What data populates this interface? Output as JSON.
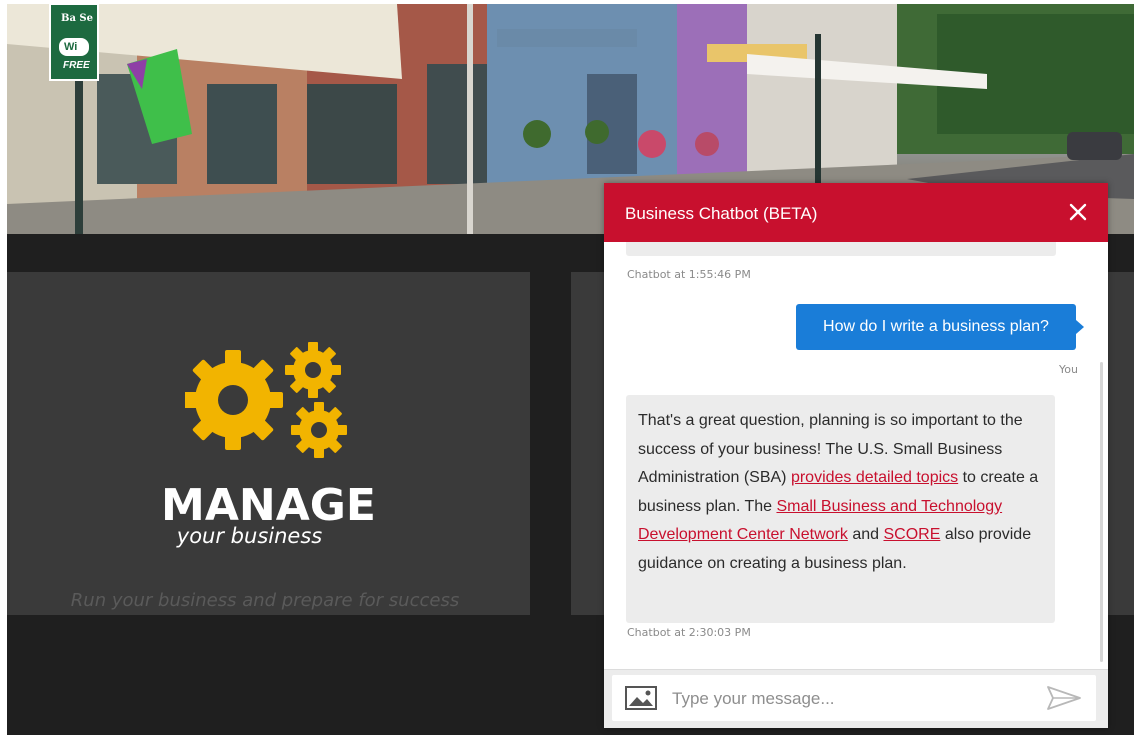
{
  "signage": {
    "sign_top": "Ba Se",
    "wifi": "Wi",
    "free": "FREE"
  },
  "manage_card": {
    "title": "MANAGE",
    "subtitle": "your business",
    "tagline": "Run your business and prepare for success"
  },
  "chatbot": {
    "title": "Business Chatbot (BETA)",
    "messages": [
      {
        "meta": "Chatbot at 1:55:46 PM"
      },
      {
        "text": "How do I write a business plan?",
        "meta": "You"
      },
      {
        "text_1": "That's a great question, planning is so important to the success of your business! The U.S. Small Business Administration (SBA) ",
        "link_1": "provides detailed topics",
        "text_2": " to create a business plan. The ",
        "link_2": "Small Business and Technology Development Center Network",
        "text_3": " and ",
        "link_3": "SCORE",
        "text_4": " also provide guidance on creating a business plan.",
        "meta": "Chatbot at 2:30:03 PM"
      }
    ],
    "input_placeholder": "Type your message..."
  },
  "colors": {
    "header_red": "#c8102e",
    "user_bubble_blue": "#1a7dd8",
    "gear_gold": "#f2b400",
    "link_red": "#c8102e"
  },
  "icons": {
    "close": "close-icon",
    "image": "image-icon",
    "send": "send-icon",
    "gears": "gears-icon",
    "wifi": "wifi-icon"
  }
}
